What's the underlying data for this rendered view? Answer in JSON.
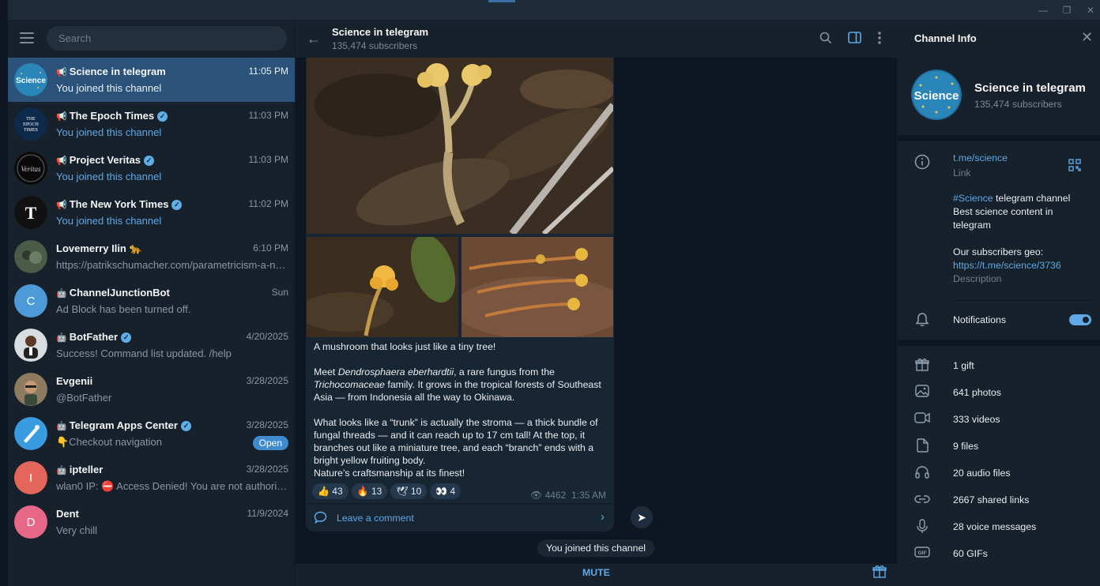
{
  "app": {
    "window_controls": {
      "minimize": "—",
      "maximize": "❐",
      "close": "✕"
    }
  },
  "search": {
    "placeholder": "Search"
  },
  "chats": [
    {
      "name": "Science in telegram",
      "time": "11:05 PM",
      "preview": "You joined this channel",
      "type": "channel",
      "verified": false,
      "active": true,
      "preview_link": false,
      "avatar": "Science"
    },
    {
      "name": "The Epoch Times",
      "time": "11:03 PM",
      "preview": "You joined this channel",
      "type": "channel",
      "verified": true,
      "active": false,
      "preview_link": true,
      "avatar": "THE EPOCH TIMES"
    },
    {
      "name": "Project Veritas",
      "time": "11:03 PM",
      "preview": "You joined this channel",
      "type": "channel",
      "verified": true,
      "active": false,
      "preview_link": true,
      "avatar": "Veritas"
    },
    {
      "name": "The New York Times",
      "time": "11:02 PM",
      "preview": "You joined this channel",
      "type": "channel",
      "verified": true,
      "active": false,
      "preview_link": true,
      "avatar": "T"
    },
    {
      "name": "Lovemerry Ilin 🐆",
      "time": "6:10 PM",
      "preview": "https://patrikschumacher.com/parametricism-a-ne...",
      "type": "user",
      "verified": false,
      "active": false,
      "preview_link": false,
      "avatar": ""
    },
    {
      "name": "ChannelJunctionBot",
      "time": "Sun",
      "preview": "Ad Block has been turned off.",
      "type": "bot",
      "verified": false,
      "active": false,
      "preview_link": false,
      "avatar": "C"
    },
    {
      "name": "BotFather",
      "time": "4/20/2025",
      "preview": "Success! Command list updated. /help",
      "type": "bot",
      "verified": true,
      "active": false,
      "preview_link": false,
      "avatar": ""
    },
    {
      "name": "Evgenii",
      "time": "3/28/2025",
      "preview": "@BotFather",
      "type": "user",
      "verified": false,
      "active": false,
      "preview_link": false,
      "avatar": ""
    },
    {
      "name": "Telegram Apps Center",
      "time": "3/28/2025",
      "preview": "👇Checkout navigation",
      "type": "bot",
      "verified": true,
      "active": false,
      "preview_link": false,
      "badge": "Open",
      "avatar": ""
    },
    {
      "name": "ipteller",
      "time": "3/28/2025",
      "preview": "wlan0 IP: ⛔ Access Denied! You are not authorized...",
      "type": "bot",
      "verified": false,
      "active": false,
      "preview_link": false,
      "avatar": "I"
    },
    {
      "name": "Dent",
      "time": "11/9/2024",
      "preview": "Very chill",
      "type": "user",
      "verified": false,
      "active": false,
      "preview_link": false,
      "avatar": "D"
    }
  ],
  "chat_header": {
    "title": "Science in telegram",
    "subtitle": "135,474 subscribers"
  },
  "post": {
    "caption_title": "A mushroom that looks just like a tiny tree!",
    "p1_a": "Meet ",
    "p1_species": "Dendrosphaera eberhardtii",
    "p1_b": ", a rare fungus from the ",
    "p1_family": "Trichocomaceae",
    "p1_c": " family. It grows in the tropical forests of Southeast Asia — from Indonesia all the way to Okinawa.",
    "p2": "What looks like a “trunk” is actually the stroma — a thick bundle of fungal threads — and it can reach up to 17 cm tall! At the top, it branches out like a miniature tree, and each “branch” ends with a bright yellow fruiting body.",
    "p3": "Nature’s craftsmanship at its finest!",
    "reactions": [
      {
        "emoji": "👍",
        "count": "43"
      },
      {
        "emoji": "🔥",
        "count": "13"
      },
      {
        "emoji": "🕊",
        "count": "10"
      },
      {
        "emoji": "👀",
        "count": "4"
      }
    ],
    "views": "4462",
    "time": "1:35 AM",
    "comment_label": "Leave a comment"
  },
  "service_message": "You joined this channel",
  "bottom": {
    "mute_label": "MUTE"
  },
  "info": {
    "title": "Channel Info",
    "name": "Science in telegram",
    "subscribers": "135,474 subscribers",
    "link": "t.me/science",
    "link_label": "Link",
    "desc_hashtag": "#Science",
    "desc_line1_rest": " telegram channel",
    "desc_line2": "Best science content in telegram",
    "desc_geo": "Our subscribers geo:",
    "desc_geo_link": "https://t.me/science/3736",
    "desc_label": "Description",
    "notifications_label": "Notifications",
    "notifications_on": true,
    "media": [
      {
        "icon": "gift-icon",
        "label": "1 gift"
      },
      {
        "icon": "photo-icon",
        "label": "641 photos"
      },
      {
        "icon": "video-icon",
        "label": "333 videos"
      },
      {
        "icon": "file-icon",
        "label": "9 files"
      },
      {
        "icon": "headphones-icon",
        "label": "20 audio files"
      },
      {
        "icon": "link-icon",
        "label": "2667 shared links"
      },
      {
        "icon": "microphone-icon",
        "label": "28 voice messages"
      },
      {
        "icon": "gif-icon",
        "label": "60 GIFs"
      }
    ]
  },
  "colors": {
    "accent": "#5fa9e6",
    "active_chat": "#2b5278",
    "panel": "#17212b",
    "background": "#0e1621"
  }
}
